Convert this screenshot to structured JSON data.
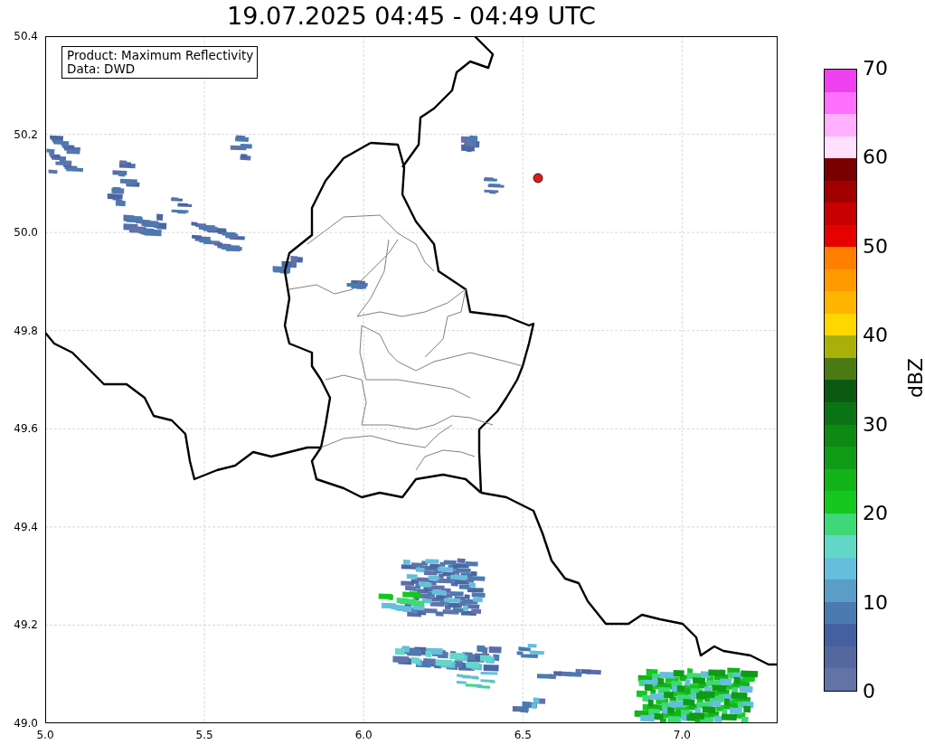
{
  "figure": {
    "title": "19.07.2025 04:45 - 04:49 UTC",
    "map": {
      "info_box": {
        "lines": [
          "Product: Maximum Reflectivity",
          "Data: DWD"
        ]
      },
      "grid": true,
      "x_ticks": [
        "5.0",
        "5.5",
        "6.0",
        "6.5",
        "7.0"
      ],
      "y_ticks": [
        "50.4",
        "50.2",
        "50.0",
        "49.8",
        "49.6",
        "49.4",
        "49.2",
        "49.0"
      ]
    },
    "colorbar": {
      "label": "dBZ",
      "ticks": [
        "70",
        "60",
        "50",
        "40",
        "30",
        "20",
        "10",
        "0"
      ],
      "bins": [
        {
          "color": "#ee40ee"
        },
        {
          "color": "#ff70ff"
        },
        {
          "color": "#ffb0ff"
        },
        {
          "color": "#ffe0ff"
        },
        {
          "color": "#7a0000"
        },
        {
          "color": "#a00000"
        },
        {
          "color": "#c80000"
        },
        {
          "color": "#e60000"
        },
        {
          "color": "#ff8000"
        },
        {
          "color": "#ff9a00"
        },
        {
          "color": "#ffb400"
        },
        {
          "color": "#ffd700"
        },
        {
          "color": "#aab00a"
        },
        {
          "color": "#4a7a14"
        },
        {
          "color": "#0a5a14"
        },
        {
          "color": "#0a7414"
        },
        {
          "color": "#0c8a14"
        },
        {
          "color": "#0e9c16"
        },
        {
          "color": "#12b41a"
        },
        {
          "color": "#14c81e"
        },
        {
          "color": "#3ed878"
        },
        {
          "color": "#64d8c8"
        },
        {
          "color": "#64bedc"
        },
        {
          "color": "#5a9ec8"
        },
        {
          "color": "#4a7ab0"
        },
        {
          "color": "#4460a0"
        },
        {
          "color": "#55679f"
        },
        {
          "color": "#6373a6"
        }
      ]
    }
  }
}
